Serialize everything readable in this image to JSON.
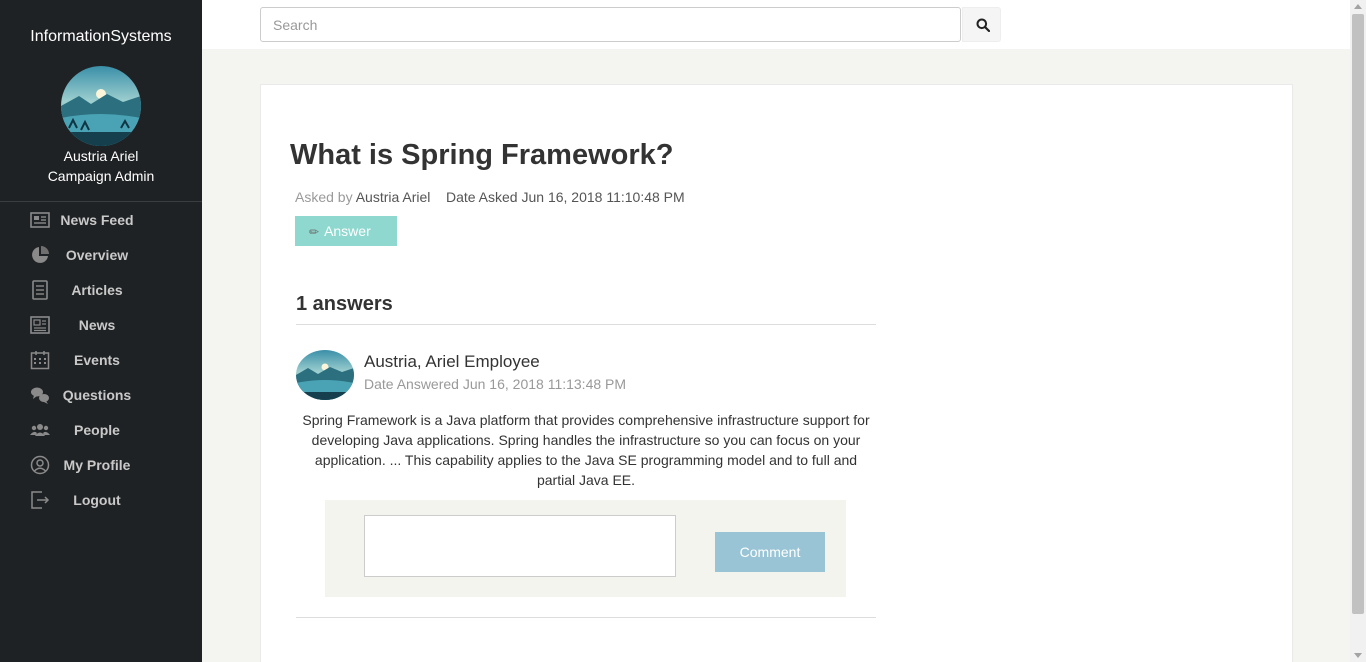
{
  "sidebar": {
    "brand": "InformationSystems",
    "user_name": "Austria Ariel",
    "user_role": "Campaign Admin",
    "items": [
      {
        "label": "News Feed",
        "icon": "newspaper-icon"
      },
      {
        "label": "Overview",
        "icon": "pie-chart-icon"
      },
      {
        "label": "Articles",
        "icon": "document-icon"
      },
      {
        "label": "News",
        "icon": "news-icon"
      },
      {
        "label": "Events",
        "icon": "calendar-icon"
      },
      {
        "label": "Questions",
        "icon": "chat-bubbles-icon"
      },
      {
        "label": "People",
        "icon": "people-icon"
      },
      {
        "label": "My Profile",
        "icon": "user-circle-icon"
      },
      {
        "label": "Logout",
        "icon": "logout-icon"
      }
    ]
  },
  "search": {
    "placeholder": "Search",
    "icon": "search-icon"
  },
  "question": {
    "title": "What is Spring Framework?",
    "asked_by_label": "Asked by",
    "asked_by": "Austria Ariel",
    "date_asked_label": "Date Asked",
    "date_asked": "Jun 16, 2018 11:10:48 PM",
    "answer_button": "Answer"
  },
  "answers": {
    "count_label": "1 answers",
    "items": [
      {
        "author": "Austria, Ariel Employee",
        "date_label": "Date Answered",
        "date": "Jun 16, 2018 11:13:48 PM",
        "body": "Spring Framework is a Java platform that provides comprehensive infrastructure support for developing Java applications. Spring handles the infrastructure so you can focus on your application. ... This capability applies to the Java SE programming model and to full and partial Java EE."
      }
    ]
  },
  "comment": {
    "button": "Comment"
  },
  "colors": {
    "sidebar_bg": "#1f2224",
    "answer_button_bg": "#8fd8cf",
    "comment_button_bg": "#99c4d5"
  }
}
